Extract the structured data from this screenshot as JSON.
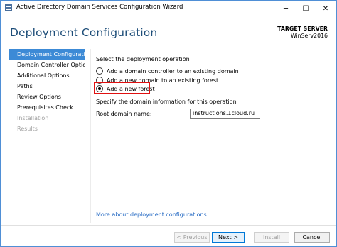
{
  "window": {
    "title": "Active Directory Domain Services Configuration Wizard",
    "controls": {
      "minimize": "─",
      "maximize": "☐",
      "close": "✕"
    }
  },
  "header": {
    "heading": "Deployment Configuration",
    "target_label": "TARGET SERVER",
    "target_value": "WinServ2016"
  },
  "sidebar": {
    "items": [
      {
        "label": "Deployment Configuration",
        "state": "active"
      },
      {
        "label": "Domain Controller Options",
        "state": "enabled"
      },
      {
        "label": "Additional Options",
        "state": "enabled"
      },
      {
        "label": "Paths",
        "state": "enabled"
      },
      {
        "label": "Review Options",
        "state": "enabled"
      },
      {
        "label": "Prerequisites Check",
        "state": "enabled"
      },
      {
        "label": "Installation",
        "state": "disabled"
      },
      {
        "label": "Results",
        "state": "disabled"
      }
    ]
  },
  "main": {
    "operation_heading": "Select the deployment operation",
    "options": [
      {
        "label": "Add a domain controller to an existing domain",
        "checked": false
      },
      {
        "label": "Add a new domain to an existing forest",
        "checked": false
      },
      {
        "label": "Add a new forest",
        "checked": true
      }
    ],
    "domain_info_heading": "Specify the domain information for this operation",
    "root_domain_label": "Root domain name:",
    "root_domain_value": "instructions.1cloud.ru",
    "help_link": "More about deployment configurations"
  },
  "footer": {
    "previous": "< Previous",
    "next": "Next >",
    "install": "Install",
    "cancel": "Cancel"
  },
  "colors": {
    "accent": "#3c8ad6",
    "heading": "#1e4e79",
    "highlight": "#e01010",
    "link": "#1f66c2"
  }
}
